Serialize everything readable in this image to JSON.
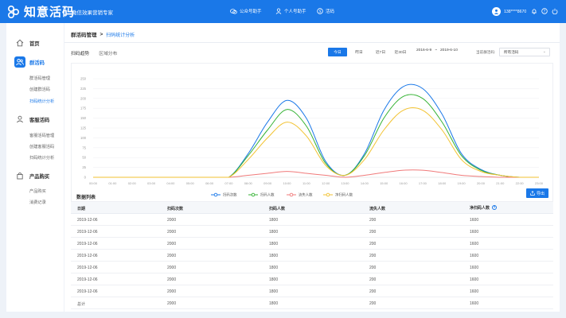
{
  "header": {
    "logo_text": "知意活码",
    "subtitle": "微信效果营销专家",
    "nav": [
      {
        "label": "公众号助手",
        "icon": "wechat-icon"
      },
      {
        "label": "个人号助手",
        "icon": "person-icon"
      },
      {
        "label": "活码",
        "icon": "qrcode-icon"
      }
    ],
    "user_phone": "138****8670"
  },
  "sidebar": {
    "home": "首页",
    "groups": [
      {
        "title": "群活码",
        "active": true,
        "items": [
          "群活码管理",
          "创建群活码",
          "扫码统计分析"
        ]
      },
      {
        "title": "客服活码",
        "active": false,
        "items": [
          "客服活码管理",
          "创建客服活码",
          "扫码统计分析"
        ]
      },
      {
        "title": "产品购买",
        "active": false,
        "items": [
          "产品购买",
          "消费记录"
        ]
      }
    ]
  },
  "breadcrumb": {
    "parent": "群活码管理",
    "current": "扫码统计分析"
  },
  "tabs": {
    "trend": "扫码趋势",
    "region": "区域分布"
  },
  "ranges": [
    "今日",
    "昨日",
    "近7日",
    "近30日"
  ],
  "date_range": {
    "start": "2016-6-9",
    "end": "2019-6-10"
  },
  "filter": {
    "label": "当前群活码:",
    "value": "所有活码"
  },
  "chart_data": {
    "type": "line",
    "x": [
      "00:00",
      "01:00",
      "02:00",
      "03:00",
      "04:00",
      "05:00",
      "06:00",
      "07:00",
      "08:00",
      "09:00",
      "10:00",
      "11:00",
      "12:00",
      "13:00",
      "14:00",
      "15:00",
      "16:00",
      "17:00",
      "18:00",
      "19:00",
      "20:00",
      "21:00",
      "22:00",
      "23:00"
    ],
    "yticks": [
      "0",
      "25",
      "50",
      "75",
      "100",
      "125",
      "150",
      "175",
      "200",
      "225",
      "250"
    ],
    "ylim": [
      0,
      250
    ],
    "series": [
      {
        "name": "扫码次数",
        "color": "#1a78e8",
        "values": [
          0,
          0,
          0,
          0,
          0,
          0,
          0,
          0,
          60,
          140,
          195,
          150,
          40,
          5,
          60,
          170,
          230,
          225,
          160,
          60,
          20,
          5,
          0,
          0
        ]
      },
      {
        "name": "扫码人数",
        "color": "#34b233",
        "values": [
          0,
          0,
          0,
          0,
          0,
          0,
          0,
          0,
          55,
          120,
          172,
          130,
          35,
          5,
          55,
          150,
          205,
          200,
          140,
          55,
          18,
          5,
          0,
          0
        ]
      },
      {
        "name": "流失人数",
        "color": "#f07a7a",
        "values": [
          0,
          0,
          0,
          0,
          0,
          0,
          0,
          0,
          5,
          10,
          15,
          10,
          5,
          0,
          5,
          12,
          18,
          18,
          12,
          5,
          2,
          0,
          0,
          0
        ]
      },
      {
        "name": "净扫码人数",
        "color": "#f2c230",
        "values": [
          0,
          0,
          0,
          0,
          0,
          0,
          0,
          0,
          45,
          100,
          140,
          105,
          30,
          5,
          45,
          120,
          170,
          170,
          120,
          45,
          15,
          5,
          0,
          0
        ]
      }
    ]
  },
  "list": {
    "title": "数据列表",
    "export_label": "导出",
    "columns": [
      "日期",
      "扫码次数",
      "扫码人数",
      "流失人数",
      "净扫码人数"
    ],
    "rows": [
      [
        "2019-12-06",
        "2000",
        "1800",
        "200",
        "1600"
      ],
      [
        "2019-12-06",
        "2000",
        "1800",
        "200",
        "1600"
      ],
      [
        "2019-12-06",
        "2000",
        "1800",
        "200",
        "1600"
      ],
      [
        "2019-12-06",
        "2000",
        "1800",
        "200",
        "1600"
      ],
      [
        "2019-12-06",
        "2000",
        "1800",
        "200",
        "1600"
      ],
      [
        "2019-12-06",
        "2000",
        "1800",
        "200",
        "1600"
      ],
      [
        "2019-12-06",
        "2000",
        "1800",
        "200",
        "1600"
      ],
      [
        "总计",
        "2000",
        "1800",
        "200",
        "1600"
      ]
    ]
  }
}
